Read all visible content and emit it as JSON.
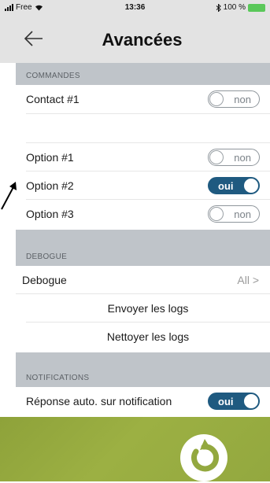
{
  "status_bar": {
    "carrier": "Free",
    "time": "13:36",
    "battery": "100 %"
  },
  "nav": {
    "title": "Avancées"
  },
  "sections": {
    "commandes": {
      "header": "COMMANDES",
      "contact_label": "Contact #1",
      "contact_toggle": "non",
      "options": [
        {
          "label": "Option #1",
          "state": "non"
        },
        {
          "label": "Option #2",
          "state": "oui"
        },
        {
          "label": "Option #3",
          "state": "non"
        }
      ]
    },
    "debogue": {
      "header": "DEBOGUE",
      "row_label": "Debogue",
      "row_value": "All >",
      "send_logs": "Envoyer les logs",
      "clear_logs": "Nettoyer les logs"
    },
    "notifications": {
      "header": "NOTIFICATIONS",
      "auto_reply_label": "Réponse auto. sur notification",
      "auto_reply_toggle": "oui"
    }
  },
  "colors": {
    "toggle_on": "#1f5a80",
    "footer": "#9cb043",
    "section_header": "#bfc4c9"
  }
}
